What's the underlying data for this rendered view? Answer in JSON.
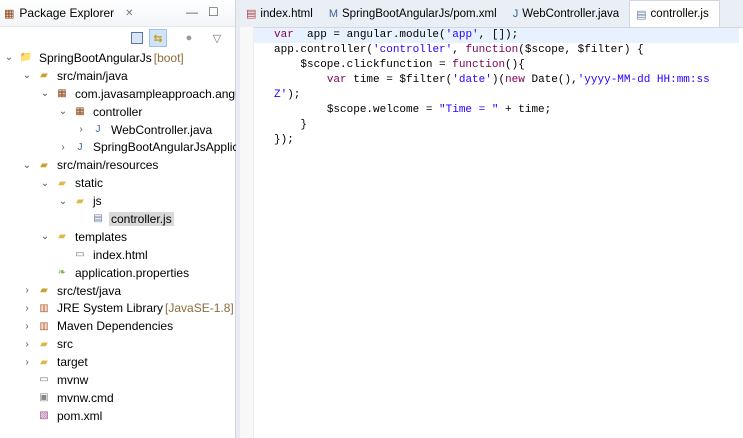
{
  "explorer": {
    "title": "Package Explorer",
    "close": "✕",
    "minimize": "—",
    "maximize": "☐"
  },
  "toolbar": {
    "collapse": "collapse-all",
    "link": "link-with-editor",
    "filters": "filters",
    "menu": "▽"
  },
  "tree": [
    {
      "label": "SpringBootAngularJs",
      "decoration": " [boot]",
      "level": 0,
      "chev": "⌄",
      "icon": "project"
    },
    {
      "label": "src/main/java",
      "level": 1,
      "chev": "⌄",
      "icon": "srcfolder"
    },
    {
      "label": "com.javasampleapproach.angularjs",
      "level": 2,
      "chev": "⌄",
      "icon": "package"
    },
    {
      "label": "controller",
      "level": 3,
      "chev": "⌄",
      "icon": "package"
    },
    {
      "label": "WebController.java",
      "level": 4,
      "chev": "›",
      "icon": "java"
    },
    {
      "label": "SpringBootAngularJsApplication.java",
      "level": 3,
      "chev": "›",
      "icon": "java"
    },
    {
      "label": "src/main/resources",
      "level": 1,
      "chev": "⌄",
      "icon": "srcfolder"
    },
    {
      "label": "static",
      "level": 2,
      "chev": "⌄",
      "icon": "folder"
    },
    {
      "label": "js",
      "level": 3,
      "chev": "⌄",
      "icon": "folder"
    },
    {
      "label": "controller.js",
      "level": 4,
      "chev": "",
      "icon": "js",
      "selected": true
    },
    {
      "label": "templates",
      "level": 2,
      "chev": "⌄",
      "icon": "folder"
    },
    {
      "label": "index.html",
      "level": 3,
      "chev": "",
      "icon": "file"
    },
    {
      "label": "application.properties",
      "level": 2,
      "chev": "",
      "icon": "props"
    },
    {
      "label": "src/test/java",
      "level": 1,
      "chev": "›",
      "icon": "srcfolder"
    },
    {
      "label": "JRE System Library",
      "decoration": " [JavaSE-1.8]",
      "level": 1,
      "chev": "›",
      "icon": "library"
    },
    {
      "label": "Maven Dependencies",
      "level": 1,
      "chev": "›",
      "icon": "library"
    },
    {
      "label": "src",
      "level": 1,
      "chev": "›",
      "icon": "folder"
    },
    {
      "label": "target",
      "level": 1,
      "chev": "›",
      "icon": "folder"
    },
    {
      "label": "mvnw",
      "level": 1,
      "chev": "",
      "icon": "file"
    },
    {
      "label": "mvnw.cmd",
      "level": 1,
      "chev": "",
      "icon": "cmd"
    },
    {
      "label": "pom.xml",
      "level": 1,
      "chev": "",
      "icon": "xml"
    }
  ],
  "tabs": [
    {
      "label": "index.html",
      "icon": "html"
    },
    {
      "label": "SpringBootAngularJs/pom.xml",
      "icon": "maven"
    },
    {
      "label": "WebController.java",
      "icon": "java"
    },
    {
      "label": "controller.js",
      "icon": "js",
      "active": true
    }
  ],
  "code": [
    [
      [
        "kw",
        "var"
      ],
      [
        "",
        "  app = angular.module("
      ],
      [
        "str",
        "'app'"
      ],
      [
        "",
        ", []);"
      ]
    ],
    [
      [
        "",
        "app.controller("
      ],
      [
        "str",
        "'controller'"
      ],
      [
        "",
        ", "
      ],
      [
        "kw",
        "function"
      ],
      [
        "",
        "($scope, $filter) {"
      ]
    ],
    [
      [
        "",
        "    $scope.clickfunction = "
      ],
      [
        "kw",
        "function"
      ],
      [
        "",
        "(){"
      ]
    ],
    [
      [
        "",
        "        "
      ],
      [
        "kw",
        "var"
      ],
      [
        "",
        " time = $filter("
      ],
      [
        "str",
        "'date'"
      ],
      [
        "",
        ")("
      ],
      [
        "kw",
        "new"
      ],
      [
        "",
        " Date(),"
      ],
      [
        "str",
        "'yyyy-MM-dd HH:mm:ss Z'"
      ],
      [
        "",
        ");"
      ]
    ],
    [
      [
        "",
        "        $scope.welcome = "
      ],
      [
        "str",
        "\"Time = \""
      ],
      [
        "",
        " + time;"
      ]
    ],
    [
      [
        "",
        "    }"
      ]
    ],
    [
      [
        "",
        "});"
      ]
    ]
  ]
}
